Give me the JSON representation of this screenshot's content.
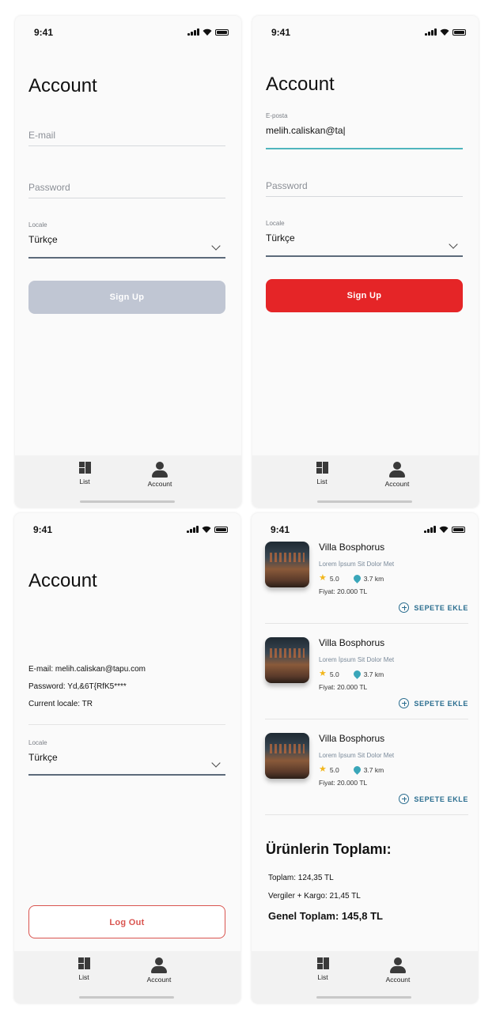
{
  "status": {
    "time": "9:41"
  },
  "tabs": {
    "list": "List",
    "account": "Account"
  },
  "screen1": {
    "title": "Account",
    "email_placeholder": "E-mail",
    "password_placeholder": "Password",
    "locale_label": "Locale",
    "locale_value": "Türkçe",
    "button": "Sign Up"
  },
  "screen2": {
    "title": "Account",
    "email_label": "E-posta",
    "email_value": "melih.caliskan@ta|",
    "password_placeholder": "Password",
    "locale_label": "Locale",
    "locale_value": "Türkçe",
    "button": "Sign Up"
  },
  "screen3": {
    "title": "Account",
    "email_line": "E-mail: melih.caliskan@tapu.com",
    "password_line": "Password: Yd,&6T{RfK5****",
    "locale_line": "Current locale: TR",
    "locale_label": "Locale",
    "locale_value": "Türkçe",
    "button": "Log Out"
  },
  "screen4": {
    "products": [
      {
        "name": "Villa Bosphorus",
        "desc": "Lorem İpsum Sit Dolor Met",
        "rating": "5.0",
        "distance": "3.7 km",
        "price": "Fiyat: 20.000 TL",
        "add": "SEPETE EKLE"
      },
      {
        "name": "Villa Bosphorus",
        "desc": "Lorem İpsum Sit Dolor Met",
        "rating": "5.0",
        "distance": "3.7 km",
        "price": "Fiyat: 20.000 TL",
        "add": "SEPETE EKLE"
      },
      {
        "name": "Villa Bosphorus",
        "desc": "Lorem İpsum Sit Dolor Met",
        "rating": "5.0",
        "distance": "3.7 km",
        "price": "Fiyat: 20.000 TL",
        "add": "SEPETE EKLE"
      }
    ],
    "summary_title": "Ürünlerin Toplamı:",
    "subtotal": "Toplam: 124,35 TL",
    "tax_shipping": "Vergiler + Kargo: 21,45 TL",
    "grand_total": "Genel Toplam: 145,8 TL"
  },
  "colors": {
    "accent_red": "#e52527",
    "accent_teal": "#4fb5bd",
    "link_blue": "#2a6d8f",
    "disabled": "#c0c6d3"
  }
}
